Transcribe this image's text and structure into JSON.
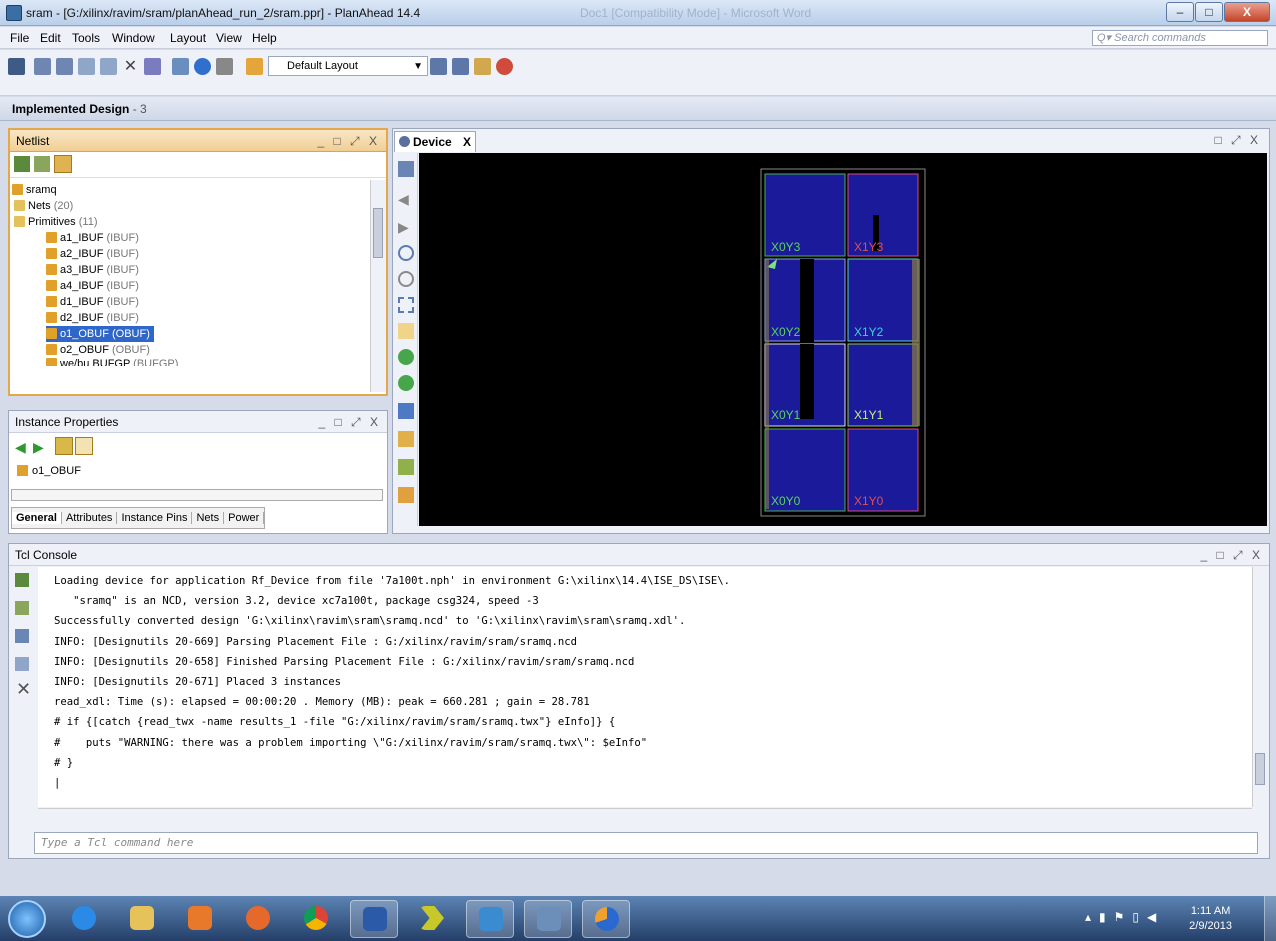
{
  "window": {
    "title": "sram - [G:/xilinx/ravim/sram/planAhead_run_2/sram.ppr] - PlanAhead 14.4",
    "ghost_title": "Doc1 [Compatibility Mode] - Microsoft Word",
    "minimize": "–",
    "maximize": "□",
    "close": "X"
  },
  "menu": [
    "File",
    "Edit",
    "Tools",
    "Window",
    "Layout",
    "View",
    "Help"
  ],
  "search": {
    "placeholder": "Q▾ Search commands"
  },
  "toolbar": {
    "layout": "Default Layout"
  },
  "implemented": {
    "title": "Implemented Design",
    "suffix": " - 3"
  },
  "netlist": {
    "title": "Netlist",
    "controls": "_ □ ⤢ X",
    "root": "sramq",
    "nets": {
      "label": "Nets",
      "count": "(20)"
    },
    "primitives": {
      "label": "Primitives",
      "count": "(11)"
    },
    "items": [
      {
        "name": "a1_IBUF",
        "type": "(IBUF)"
      },
      {
        "name": "a2_IBUF",
        "type": "(IBUF)"
      },
      {
        "name": "a3_IBUF",
        "type": "(IBUF)"
      },
      {
        "name": "a4_IBUF",
        "type": "(IBUF)"
      },
      {
        "name": "d1_IBUF",
        "type": "(IBUF)"
      },
      {
        "name": "d2_IBUF",
        "type": "(IBUF)"
      },
      {
        "name": "o1_OBUF",
        "type": "(OBUF)"
      },
      {
        "name": "o2_OBUF",
        "type": "(OBUF)"
      },
      {
        "name": "we/bu BUFGP",
        "type": "(BUFGP)"
      }
    ]
  },
  "instance_properties": {
    "title": "Instance Properties",
    "controls": "_ □ ⤢ X",
    "selected": "o1_OBUF",
    "tabs": [
      "General",
      "Attributes",
      "Instance Pins",
      "Nets",
      "Power"
    ]
  },
  "device": {
    "tab": "Device",
    "tab_close": "X",
    "controls": "□ ⤢ X",
    "regions": [
      "X0Y3",
      "X1Y3",
      "X0Y2",
      "X1Y2",
      "X0Y1",
      "X1Y1",
      "X0Y0",
      "X1Y0"
    ]
  },
  "console": {
    "title": "Tcl Console",
    "controls": "_ □ ⤢ X",
    "lines": [
      "Loading device for application Rf_Device from file '7a100t.nph' in environment G:\\xilinx\\14.4\\ISE_DS\\ISE\\.",
      "   \"sramq\" is an NCD, version 3.2, device xc7a100t, package csg324, speed -3",
      "Successfully converted design 'G:\\xilinx\\ravim\\sram\\sramq.ncd' to 'G:\\xilinx\\ravim\\sram\\sramq.xdl'.",
      "INFO: [Designutils 20-669] Parsing Placement File : G:/xilinx/ravim/sram/sramq.ncd",
      "INFO: [Designutils 20-658] Finished Parsing Placement File : G:/xilinx/ravim/sram/sramq.ncd",
      "INFO: [Designutils 20-671] Placed 3 instances",
      "read_xdl: Time (s): elapsed = 00:00:20 . Memory (MB): peak = 660.281 ; gain = 28.781",
      "# if {[catch {read_twx -name results_1 -file \"G:/xilinx/ravim/sram/sramq.twx\"} eInfo]} {",
      "#    puts \"WARNING: there was a problem importing \\\"G:/xilinx/ravim/sram/sramq.twx\\\": $eInfo\"",
      "# }",
      "|"
    ],
    "input_placeholder": "Type a Tcl command here"
  },
  "taskbar": {
    "time": "1:11 AM",
    "date": "2/9/2013"
  }
}
